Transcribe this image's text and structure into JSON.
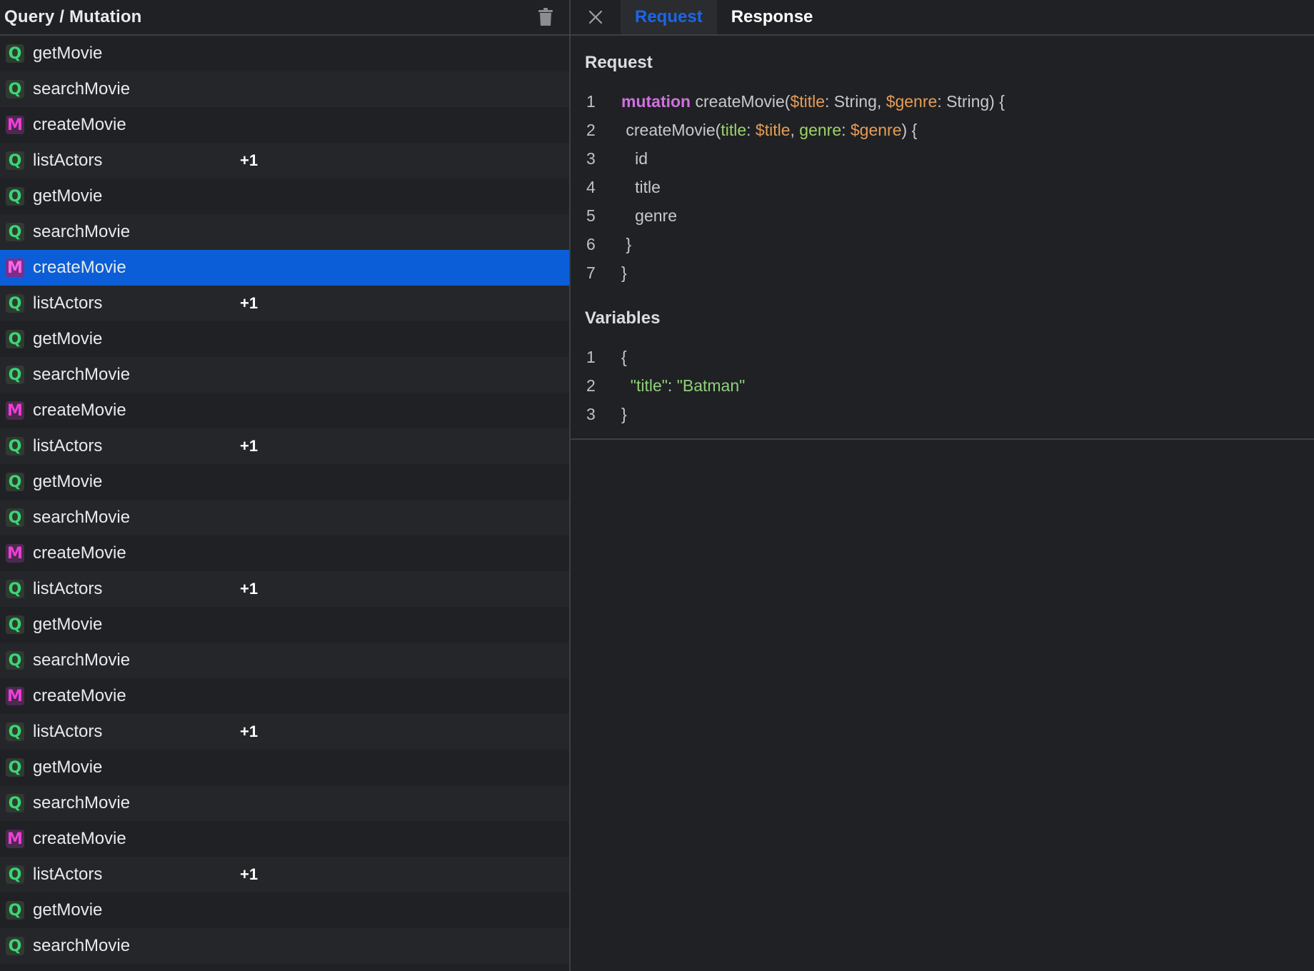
{
  "left": {
    "title": "Query / Mutation",
    "operations": [
      {
        "type": "Q",
        "name": "getMovie",
        "extra": ""
      },
      {
        "type": "Q",
        "name": "searchMovie",
        "extra": ""
      },
      {
        "type": "M",
        "name": "createMovie",
        "extra": ""
      },
      {
        "type": "Q",
        "name": "listActors",
        "extra": "+1"
      },
      {
        "type": "Q",
        "name": "getMovie",
        "extra": ""
      },
      {
        "type": "Q",
        "name": "searchMovie",
        "extra": ""
      },
      {
        "type": "M",
        "name": "createMovie",
        "extra": "",
        "selected": true
      },
      {
        "type": "Q",
        "name": "listActors",
        "extra": "+1"
      },
      {
        "type": "Q",
        "name": "getMovie",
        "extra": ""
      },
      {
        "type": "Q",
        "name": "searchMovie",
        "extra": ""
      },
      {
        "type": "M",
        "name": "createMovie",
        "extra": ""
      },
      {
        "type": "Q",
        "name": "listActors",
        "extra": "+1"
      },
      {
        "type": "Q",
        "name": "getMovie",
        "extra": ""
      },
      {
        "type": "Q",
        "name": "searchMovie",
        "extra": ""
      },
      {
        "type": "M",
        "name": "createMovie",
        "extra": ""
      },
      {
        "type": "Q",
        "name": "listActors",
        "extra": "+1"
      },
      {
        "type": "Q",
        "name": "getMovie",
        "extra": ""
      },
      {
        "type": "Q",
        "name": "searchMovie",
        "extra": ""
      },
      {
        "type": "M",
        "name": "createMovie",
        "extra": ""
      },
      {
        "type": "Q",
        "name": "listActors",
        "extra": "+1"
      },
      {
        "type": "Q",
        "name": "getMovie",
        "extra": ""
      },
      {
        "type": "Q",
        "name": "searchMovie",
        "extra": ""
      },
      {
        "type": "M",
        "name": "createMovie",
        "extra": ""
      },
      {
        "type": "Q",
        "name": "listActors",
        "extra": "+1"
      },
      {
        "type": "Q",
        "name": "getMovie",
        "extra": ""
      },
      {
        "type": "Q",
        "name": "searchMovie",
        "extra": ""
      }
    ]
  },
  "tabs": {
    "request": "Request",
    "response": "Response",
    "active": "request"
  },
  "request": {
    "section_title": "Request",
    "lines": [
      {
        "n": "1",
        "tokens": [
          [
            "kw",
            "mutation"
          ],
          [
            "pun",
            " "
          ],
          [
            "fn",
            "createMovie("
          ],
          [
            "var",
            "$title"
          ],
          [
            "pun",
            ": String, "
          ],
          [
            "var",
            "$genre"
          ],
          [
            "pun",
            ": String) {"
          ]
        ]
      },
      {
        "n": "2",
        "tokens": [
          [
            "pun",
            " "
          ],
          [
            "fn",
            "createMovie("
          ],
          [
            "arg",
            "title"
          ],
          [
            "pun",
            ": "
          ],
          [
            "var",
            "$title"
          ],
          [
            "pun",
            ", "
          ],
          [
            "arg",
            "genre"
          ],
          [
            "pun",
            ": "
          ],
          [
            "var",
            "$genre"
          ],
          [
            "pun",
            ") {"
          ]
        ]
      },
      {
        "n": "3",
        "tokens": [
          [
            "fld",
            "   id"
          ]
        ]
      },
      {
        "n": "4",
        "tokens": [
          [
            "fld",
            "   title"
          ]
        ]
      },
      {
        "n": "5",
        "tokens": [
          [
            "fld",
            "   genre"
          ]
        ]
      },
      {
        "n": "6",
        "tokens": [
          [
            "pun",
            " }"
          ]
        ]
      },
      {
        "n": "7",
        "tokens": [
          [
            "pun",
            "}"
          ]
        ]
      }
    ]
  },
  "variables": {
    "section_title": "Variables",
    "lines": [
      {
        "n": "1",
        "tokens": [
          [
            "pun",
            "{"
          ]
        ]
      },
      {
        "n": "2",
        "tokens": [
          [
            "str",
            "  \"title\""
          ],
          [
            "pun",
            ": "
          ],
          [
            "str",
            "\"Batman\""
          ]
        ]
      },
      {
        "n": "3",
        "tokens": [
          [
            "pun",
            "}"
          ]
        ]
      }
    ]
  },
  "colors": {
    "accent": "#0b5ed7",
    "query_badge": "#3bd671",
    "mutation_badge": "#ef3ed8",
    "active_tab_text": "#1a66e8"
  },
  "icons": {
    "trash": "trash-icon",
    "close": "close-icon"
  }
}
